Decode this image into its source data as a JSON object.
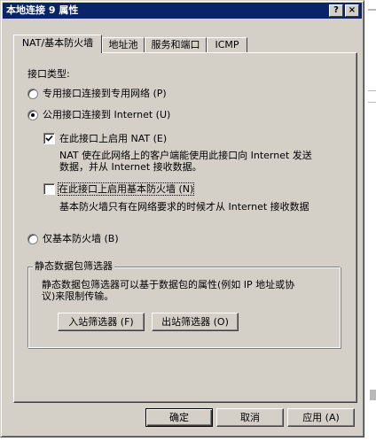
{
  "window": {
    "title": "本地连接 9 属性",
    "help_label": "?",
    "close_label": "×"
  },
  "tabs": [
    {
      "label": "NAT/基本防火墙",
      "active": true
    },
    {
      "label": "地址池",
      "active": false
    },
    {
      "label": "服务和端口",
      "active": false
    },
    {
      "label": "ICMP",
      "active": false
    }
  ],
  "interface": {
    "type_label": "接口类型:",
    "private_label": "专用接口连接到专用网络 (P)",
    "public_label": "公用接口连接到 Internet (U)",
    "enable_nat_label": "在此接口上启用 NAT (E)",
    "nat_desc_line1": "NAT 使在此网络上的客户端能使用此接口向 Internet 发送",
    "nat_desc_line2": "数据，并从 Internet 接收数据。",
    "enable_firewall_label": "在此接口上启用基本防火墙 (N)",
    "firewall_desc": "基本防火墙只有在网络要求的时候才从 Internet 接收数据",
    "basic_firewall_only_label": "仅基本防火墙 (B)",
    "private_selected": false,
    "public_selected": true,
    "basic_only_selected": false,
    "nat_checked": true,
    "firewall_checked": false
  },
  "static_filters": {
    "group_label": "静态数据包筛选器",
    "desc_line1": "静态数据包筛选器可以基于数据包的属性(例如 IP 地址或协",
    "desc_line2": "议)来限制传输。",
    "inbound_button": "入站筛选器 (F)",
    "outbound_button": "出站筛选器 (O)"
  },
  "footer": {
    "ok": "确定",
    "cancel": "取消",
    "apply": "应用 (A)"
  }
}
